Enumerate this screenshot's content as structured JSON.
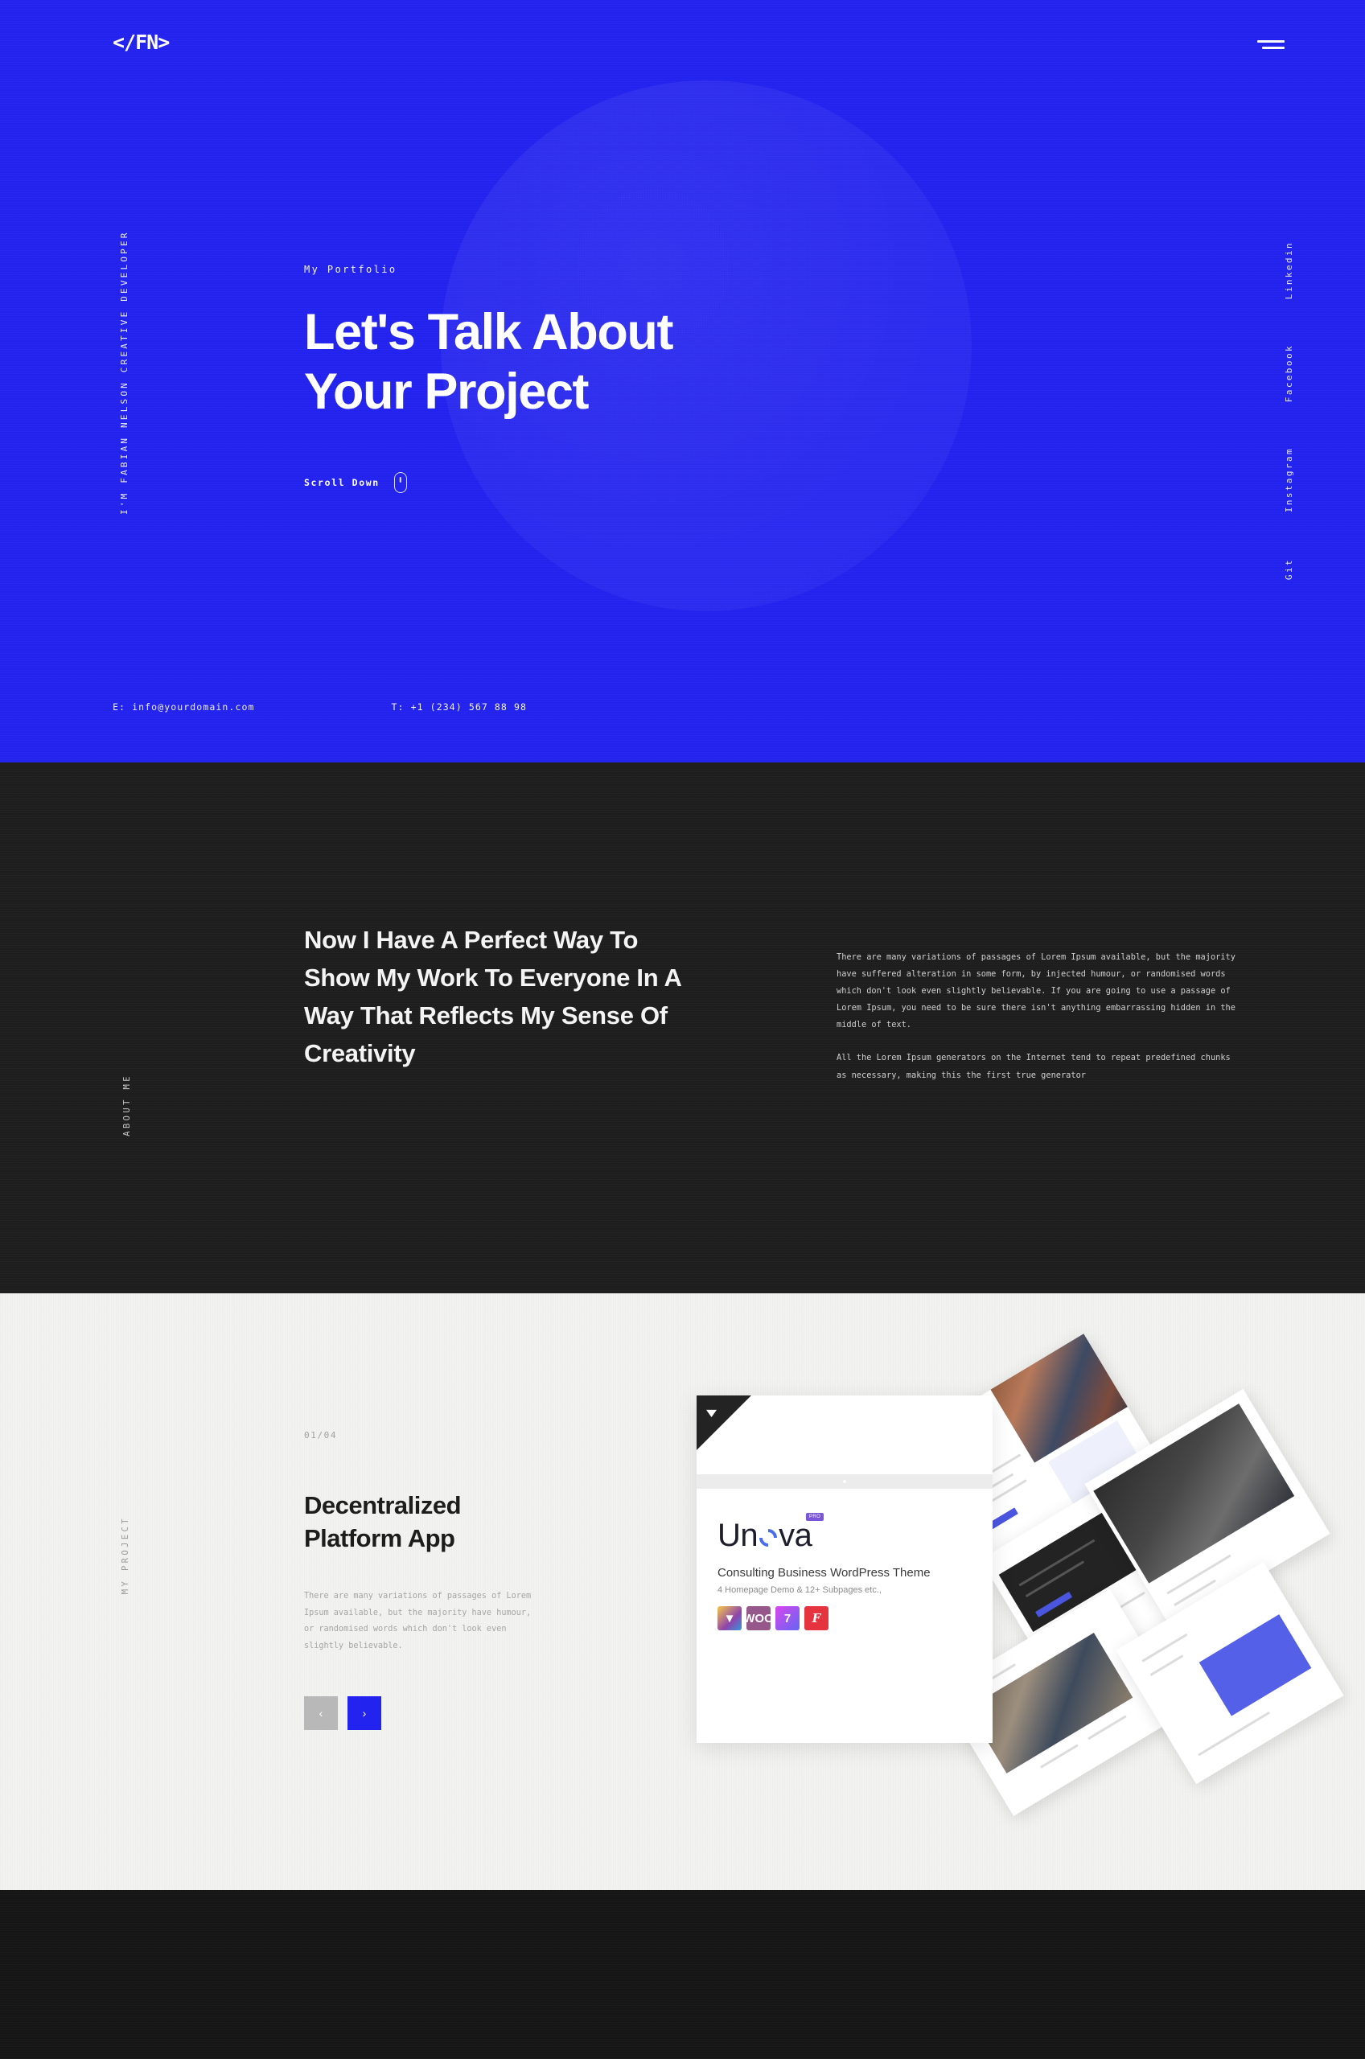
{
  "colors": {
    "brand_blue": "#2323ef",
    "dark": "#1e1e1e",
    "light": "#f2f2f0",
    "footer": "#161616",
    "nav_prev": "#b8b8b8"
  },
  "header": {
    "logo": "</FN>",
    "menu_icon": "hamburger-icon"
  },
  "hero": {
    "vertical_tagline": "I'M FABIAN NELSON CREATIVE DEVELOPER",
    "eyebrow": "My Portfolio",
    "title_line1": "Let's Talk About",
    "title_line2": "Your Project",
    "scroll_label": "Scroll Down",
    "scroll_icon": "mouse-scroll-icon",
    "email": "E: info@yourdomain.com",
    "phone": "T: +1 (234) 567 88 98",
    "social": [
      {
        "label": "Linkedin"
      },
      {
        "label": "Facebook"
      },
      {
        "label": "Instagram"
      },
      {
        "label": "Git"
      }
    ]
  },
  "about": {
    "vertical_label": "ABOUT ME",
    "heading": "Now I Have A Perfect Way To Show My Work To Everyone In A Way That Reflects My Sense Of Creativity",
    "paragraph1": "There are many variations of passages of Lorem Ipsum available, but the majority have suffered alteration in some form, by injected humour, or randomised words which don't look even slightly believable. If you are going to use a passage of Lorem Ipsum, you need to be sure there isn't anything embarrassing hidden in the middle of text.",
    "paragraph2": "All the Lorem Ipsum generators on the Internet tend to repeat predefined chunks as necessary, making this the first true generator"
  },
  "project": {
    "vertical_label": "MY PROJECT",
    "counter": "01/04",
    "title_line1": "Decentralized",
    "title_line2": "Platform App",
    "description": "There are many variations of passages of Lorem Ipsum available, but the majority have humour, or randomised words which don't look even slightly believable.",
    "prev_label": "‹",
    "next_label": "›",
    "prev_icon": "chevron-left-icon",
    "next_icon": "chevron-right-icon",
    "mockup": {
      "brand_prefix": "Un",
      "brand_suffix": "va",
      "badge": "PRO",
      "subtitle": "Consulting Business WordPress Theme",
      "subtitle2": "4 Homepage Demo & 12+ Subpages etc.,",
      "plugin_badges": [
        {
          "name": "visual-composer-icon",
          "glyph": "▼"
        },
        {
          "name": "woocommerce-icon",
          "glyph": "WOO"
        },
        {
          "name": "revolution-slider-icon",
          "glyph": "7"
        },
        {
          "name": "font-awesome-icon",
          "glyph": "F"
        }
      ]
    }
  }
}
